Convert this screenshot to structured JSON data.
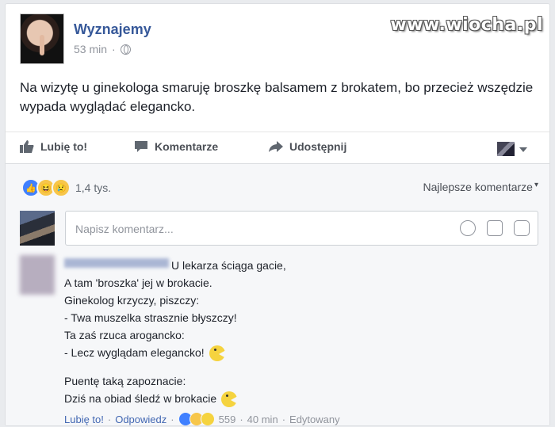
{
  "watermark": "www.wiocha.pl",
  "post": {
    "author": "Wyznajemy",
    "time": "53 min",
    "separator": "·",
    "text": "Na wizytę u ginekologa smaruję broszkę balsamem z brokatem, bo przecież wszędzie wypada wyglądać elegancko."
  },
  "actions": {
    "like": "Lubię to!",
    "comment": "Komentarze",
    "share": "Udostępnij"
  },
  "reactions": {
    "count": "1,4 tys.",
    "types": [
      "like",
      "haha",
      "sad"
    ],
    "sort_label": "Najlepsze komentarze"
  },
  "composer": {
    "placeholder": "Napisz komentarz..."
  },
  "comment": {
    "lines": [
      "U lekarza ściąga gacie,",
      "A tam 'broszka' jej w brokacie.",
      "Ginekolog krzyczy, piszczy:",
      "- Twa muszelka strasznie błyszczy!",
      "Ta zaś rzuca arogancko:",
      "- Lecz wyglądam elegancko!",
      "Puentę taką zapoznacie:",
      "Dziś na obiad śledź w brokacie"
    ],
    "like": "Lubię to!",
    "reply": "Odpowiedz",
    "reaction_count": "559",
    "time": "40 min",
    "edited": "Edytowany",
    "separator": "·"
  },
  "colors": {
    "link": "#365899",
    "text": "#1d2129",
    "muted": "#90949c",
    "like_blue": "#4080ff"
  }
}
